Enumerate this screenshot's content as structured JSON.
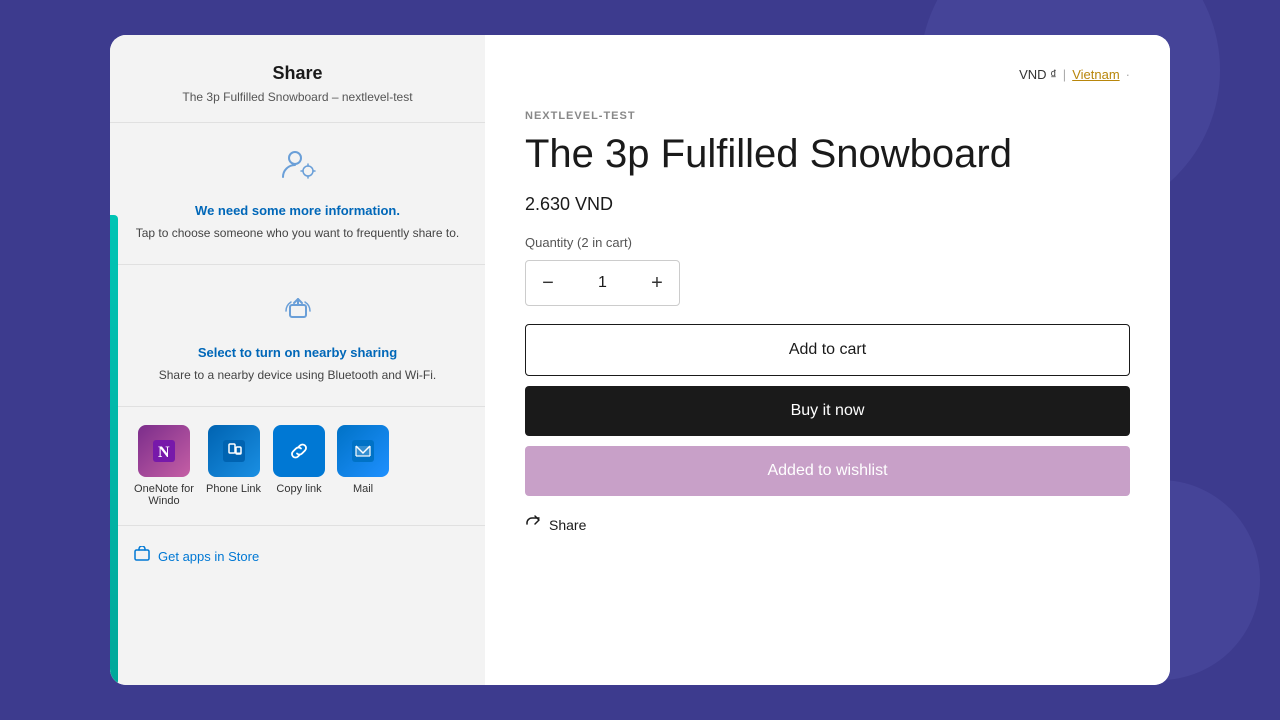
{
  "background": {
    "color": "#3d3b8e"
  },
  "share_panel": {
    "title": "Share",
    "subtitle": "The 3p Fulfilled Snowboard – nextlevel-test",
    "info_section": {
      "icon": "👤",
      "link_text": "We need some more information.",
      "description": "Tap to choose someone who you want to frequently share to."
    },
    "nearby_section": {
      "icon": "📤",
      "link_text": "Select to turn on nearby sharing",
      "description": "Share to a nearby device using Bluetooth and Wi-Fi."
    },
    "apps": [
      {
        "name": "OneNote for Windo",
        "icon_type": "onenote",
        "emoji": "📓"
      },
      {
        "name": "Phone Link",
        "icon_type": "phonelink",
        "emoji": "📱"
      },
      {
        "name": "Copy link",
        "icon_type": "copylink",
        "emoji": "🔗"
      },
      {
        "name": "Mail",
        "icon_type": "mail",
        "emoji": "✉"
      }
    ],
    "get_apps_label": "Get apps in Store"
  },
  "product_panel": {
    "currency": "VND ₫",
    "currency_divider": "|",
    "country": "Vietnam",
    "dot": "·",
    "brand": "NEXTLEVEL-TEST",
    "title": "The 3p Fulfilled Snowboard",
    "price": "2.630 VND",
    "quantity_label": "Quantity (2 in cart)",
    "quantity_value": "1",
    "btn_add_cart": "Add to cart",
    "btn_buy_now": "Buy it now",
    "btn_wishlist": "Added to wishlist",
    "share_label": "Share"
  }
}
